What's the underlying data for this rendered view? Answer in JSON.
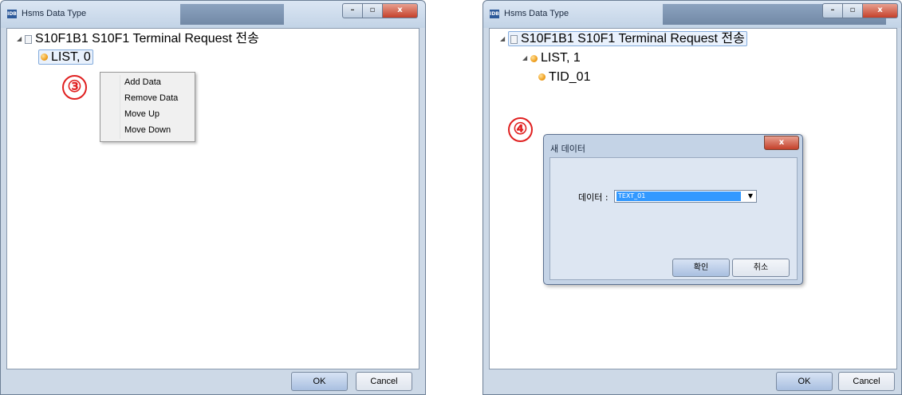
{
  "left_window": {
    "app_icon": "IDB",
    "title": "Hsms Data Type",
    "tree": {
      "root_label": "S10F1B1 S10F1 Terminal Request 전송",
      "child_label": "LIST, 0"
    },
    "marker": "③",
    "context_menu": {
      "items": [
        "Add Data",
        "Remove Data",
        "Move Up",
        "Move Down"
      ]
    },
    "buttons": {
      "ok": "OK",
      "cancel": "Cancel"
    }
  },
  "right_window": {
    "app_icon": "IDB",
    "title": "Hsms Data Type",
    "tree": {
      "root_label": "S10F1B1 S10F1 Terminal Request 전송",
      "child_label": "LIST, 1",
      "grandchild_label": "TID_01"
    },
    "marker": "④",
    "buttons": {
      "ok": "OK",
      "cancel": "Cancel"
    }
  },
  "dialog": {
    "title": "새 데이터",
    "field_label": "데이터 :",
    "field_value": "TEXT_01",
    "confirm_label": "확인",
    "cancel_label": "취소"
  },
  "icons": {
    "window_controls": [
      "minimize-icon",
      "maximize-icon",
      "close-icon"
    ],
    "close_glyph": "x",
    "tree_nodes": [
      "document-icon",
      "orange-dot-icon"
    ]
  },
  "colors": {
    "marker": "#e02020",
    "selection": "#3399ff",
    "node_dot": "#f0a020"
  }
}
